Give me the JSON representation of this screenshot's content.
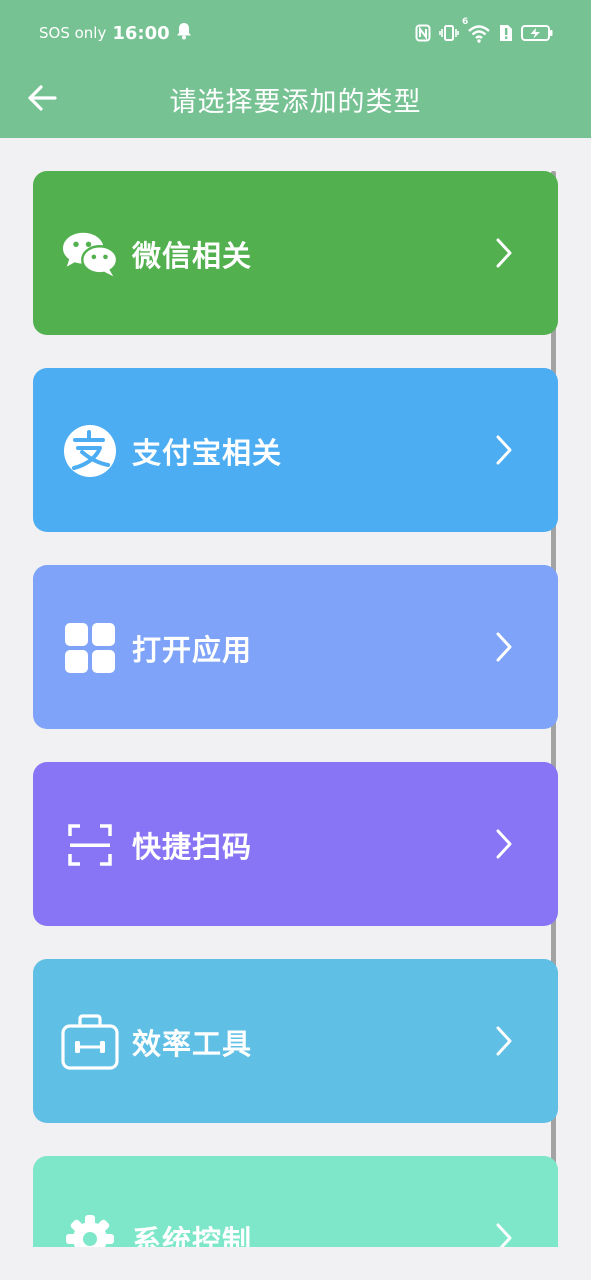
{
  "status_bar": {
    "carrier": "SOS only",
    "time": "16:00",
    "network_badge": "6"
  },
  "header": {
    "title": "请选择要添加的类型"
  },
  "categories": [
    {
      "label": "微信相关",
      "color": "#52b04f",
      "icon": "wechat-icon"
    },
    {
      "label": "支付宝相关",
      "color": "#4cadf3",
      "icon": "alipay-icon"
    },
    {
      "label": "打开应用",
      "color": "#7ea3f8",
      "icon": "apps-grid-icon"
    },
    {
      "label": "快捷扫码",
      "color": "#8875f5",
      "icon": "scan-icon"
    },
    {
      "label": "效率工具",
      "color": "#5fbfe4",
      "icon": "toolbox-icon"
    },
    {
      "label": "系统控制",
      "color": "#7fe7c9",
      "icon": "gear-icon"
    }
  ],
  "theme": {
    "header_bg": "#76c293",
    "page_bg": "#f1f1f3"
  }
}
